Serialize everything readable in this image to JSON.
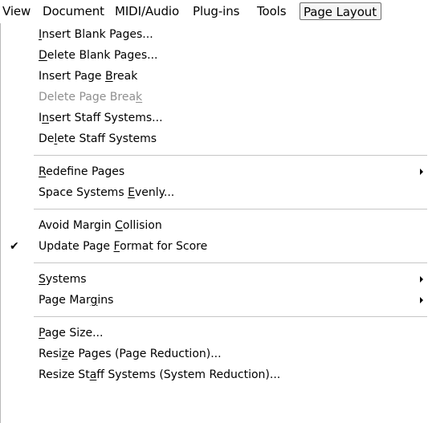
{
  "menubar": {
    "items": [
      "View",
      "Document",
      "MIDI/Audio",
      "Plug-ins",
      "Tools",
      "Page Layout"
    ]
  },
  "page_layout_menu": {
    "items": [
      {
        "pre": "",
        "u": "I",
        "post": "nsert Blank Pages..."
      },
      {
        "pre": "",
        "u": "D",
        "post": "elete Blank Pages..."
      },
      {
        "pre": "Insert Page ",
        "u": "B",
        "post": "reak"
      },
      {
        "pre": "Delete Page Brea",
        "u": "k",
        "post": "",
        "disabled": true
      },
      {
        "pre": "I",
        "u": "n",
        "post": "sert Staff Systems..."
      },
      {
        "pre": "De",
        "u": "l",
        "post": "ete Staff Systems"
      },
      {
        "pre": "",
        "u": "R",
        "post": "edefine Pages",
        "submenu": true
      },
      {
        "pre": "Space Systems ",
        "u": "E",
        "post": "venly..."
      },
      {
        "pre": "Avoid Margin ",
        "u": "C",
        "post": "ollision"
      },
      {
        "pre": "Update Page ",
        "u": "F",
        "post": "ormat for Score",
        "checked": true
      },
      {
        "pre": "",
        "u": "S",
        "post": "ystems",
        "submenu": true
      },
      {
        "pre": "Page Mar",
        "u": "g",
        "post": "ins",
        "submenu": true
      },
      {
        "pre": "",
        "u": "P",
        "post": "age Size..."
      },
      {
        "pre": "Resi",
        "u": "z",
        "post": "e Pages (Page Reduction)..."
      },
      {
        "pre": "Resize St",
        "u": "a",
        "post": "ff Systems (System Reduction)..."
      }
    ],
    "check_glyph": "✔"
  }
}
